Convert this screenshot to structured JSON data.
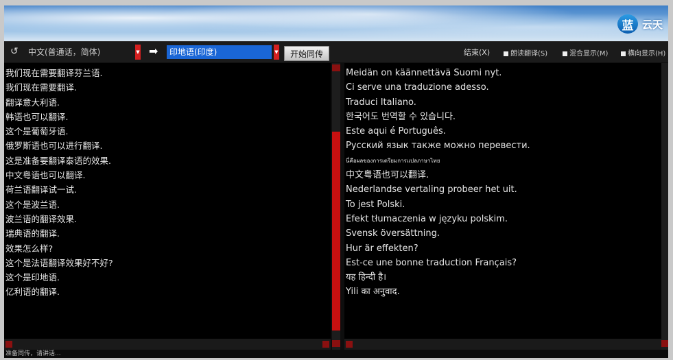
{
  "brand": {
    "badge": "蓝",
    "name": "云天"
  },
  "toolbar": {
    "refresh_icon": "↺",
    "source_language": "中文(普通话，简体)",
    "arrow_icon": "➡",
    "target_language": "印地语(印度)",
    "start_label": "开始同传",
    "end_label": "结束(X)",
    "options": [
      "朗读翻译(S)",
      "混合显示(M)",
      "横向显示(H)"
    ]
  },
  "source_lines": [
    "我们现在需要翻译芬兰语.",
    "我们现在需要翻译.",
    "翻译意大利语.",
    "韩语也可以翻译.",
    "这个是葡萄牙语.",
    "俄罗斯语也可以进行翻译.",
    "这是准备要翻译泰语的效果.",
    "中文粤语也可以翻译.",
    "荷兰语翻译试一试.",
    "这个是波兰语.",
    "波兰语的翻译效果.",
    "瑞典语的翻译.",
    "效果怎么样?",
    "这个是法语翻译效果好不好?",
    "这个是印地语.",
    "亿利语的翻译."
  ],
  "target_lines": [
    "Meidän on käännettävä Suomi nyt.",
    "Ci serve una traduzione adesso.",
    "Traduci Italiano.",
    "한국어도 번역할 수 있습니다.",
    "Este aqui é Português.",
    "Русский язык также можно перевести.",
    "นี่คือผลของการเตรียมการแปลภาษาไทย",
    "中文粤语也可以翻译.",
    "Nederlandse vertaling probeer het uit.",
    "To jest Polski.",
    "Efekt tłumaczenia w języku polskim.",
    "Svensk översättning.",
    "Hur är effekten?",
    "Est-ce une bonne traduction Français?",
    "यह हिन्दी है।",
    "Yili का अनुवाद."
  ],
  "status_text": "准备同传，请讲话..."
}
